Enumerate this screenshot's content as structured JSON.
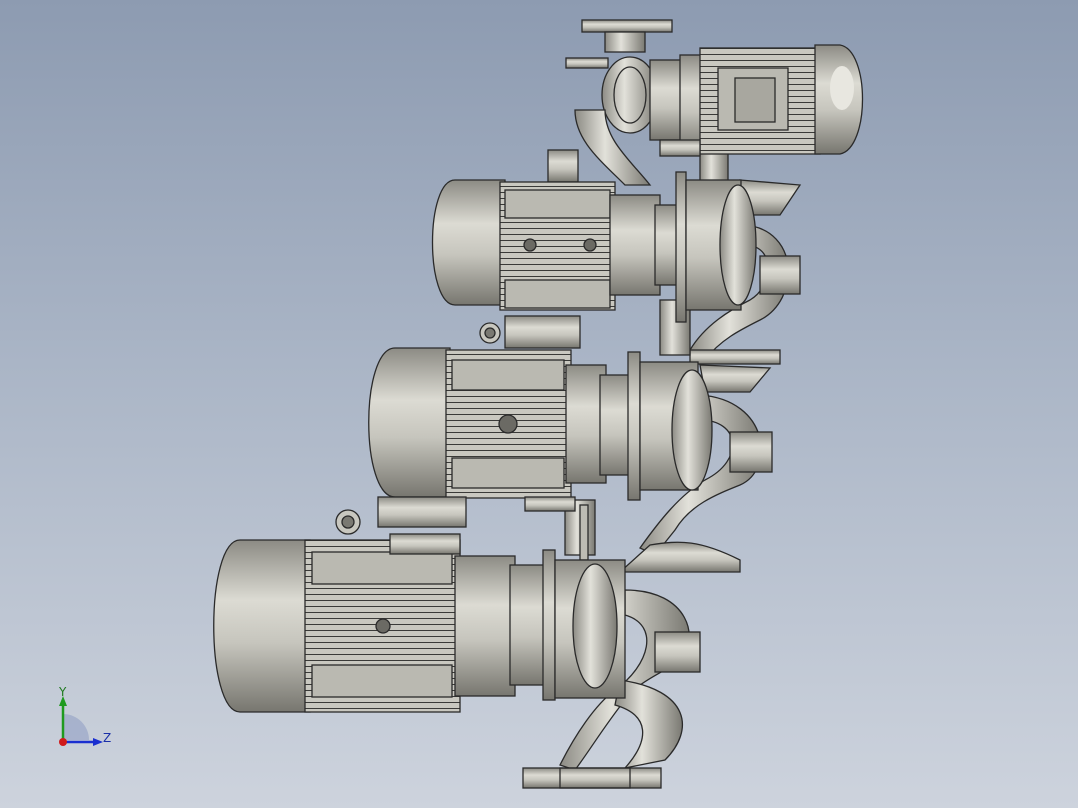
{
  "viewport": {
    "name": "3d-model-viewport",
    "background_top": "#8d9bb1",
    "background_bottom": "#cdd3dd"
  },
  "model": {
    "description_icon": "pump-assembly-icon",
    "body_color": "#c2c1b8",
    "edge_color": "#2a2a2a"
  },
  "triad": {
    "y_label": "Y",
    "z_label": "Z",
    "y_color": "#1f9a1f",
    "z_color": "#1a2fd0",
    "x_color": "#d01a1a"
  }
}
